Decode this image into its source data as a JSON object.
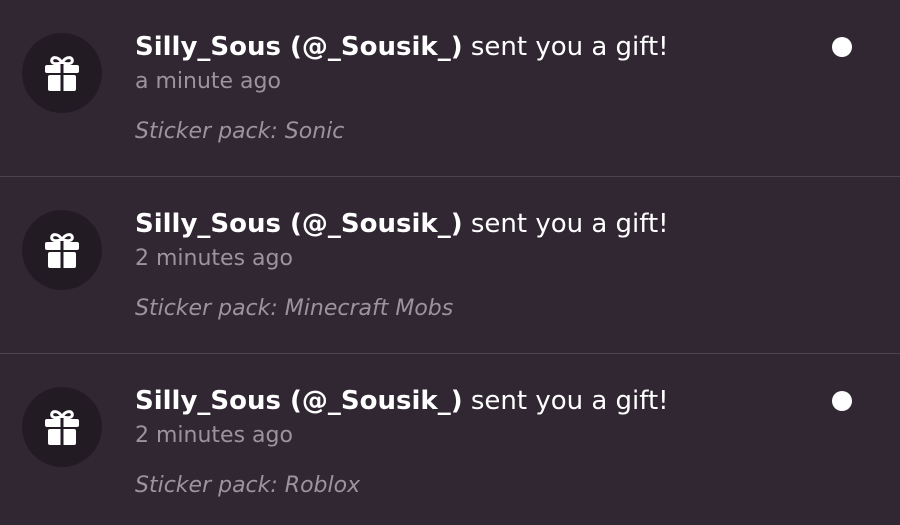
{
  "notifications": [
    {
      "sender": "Silly_Sous (@_Sousik_)",
      "action": "sent you a gift!",
      "time": "a minute ago",
      "detail": "Sticker pack: Sonic",
      "unread": true,
      "icon": "gift-icon"
    },
    {
      "sender": "Silly_Sous (@_Sousik_)",
      "action": "sent you a gift!",
      "time": "2 minutes ago",
      "detail": "Sticker pack: Minecraft Mobs",
      "unread": false,
      "icon": "gift-icon"
    },
    {
      "sender": "Silly_Sous (@_Sousik_)",
      "action": "sent you a gift!",
      "time": "2 minutes ago",
      "detail": "Sticker pack: Roblox",
      "unread": true,
      "icon": "gift-icon"
    }
  ],
  "colors": {
    "background": "#302732",
    "avatar_bg": "#221b24",
    "divider": "#4b4350",
    "primary_text": "#ffffff",
    "secondary_text": "#9b93a0",
    "unread_dot": "#ffffff"
  }
}
